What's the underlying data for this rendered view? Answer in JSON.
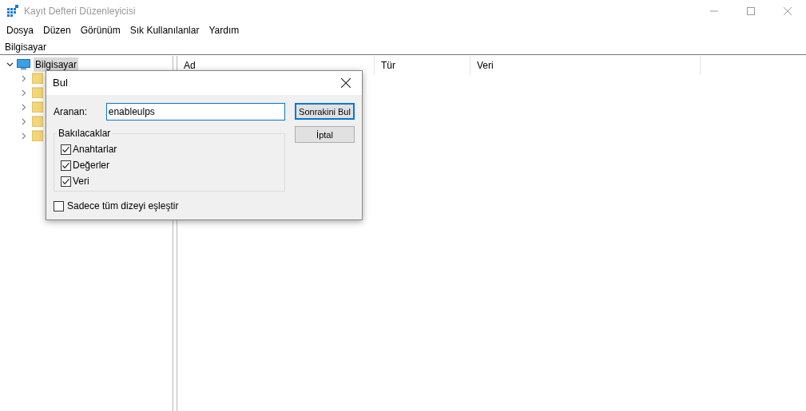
{
  "window": {
    "title": "Kayıt Defteri Düzenleyicisi"
  },
  "menu": [
    "Dosya",
    "Düzen",
    "Görünüm",
    "Sık Kullanılanlar",
    "Yardım"
  ],
  "address_bar": {
    "value": "Bilgisayar"
  },
  "tree": {
    "label": "Bilgisayar",
    "selected": true,
    "expanded": true,
    "children": [
      {
        "expanded": false
      },
      {
        "expanded": false
      },
      {
        "expanded": false
      },
      {
        "expanded": false
      },
      {
        "expanded": false
      }
    ]
  },
  "list": {
    "columns": [
      "Ad",
      "Tür",
      "Veri"
    ]
  },
  "find_dialog": {
    "title": "Bul",
    "search_label": "Aranan:",
    "search_value": "enableulps",
    "group_title": "Bakılacaklar",
    "options": [
      {
        "label": "Anahtarlar",
        "checked": true
      },
      {
        "label": "Değerler",
        "checked": true
      },
      {
        "label": "Veri",
        "checked": true
      }
    ],
    "whole_match": {
      "label": "Sadece tüm dizeyi eşleştir",
      "checked": false
    },
    "buttons": [
      {
        "label": "Sonrakini Bul",
        "kind": "default"
      },
      {
        "label": "İptal",
        "kind": "normal"
      }
    ]
  }
}
